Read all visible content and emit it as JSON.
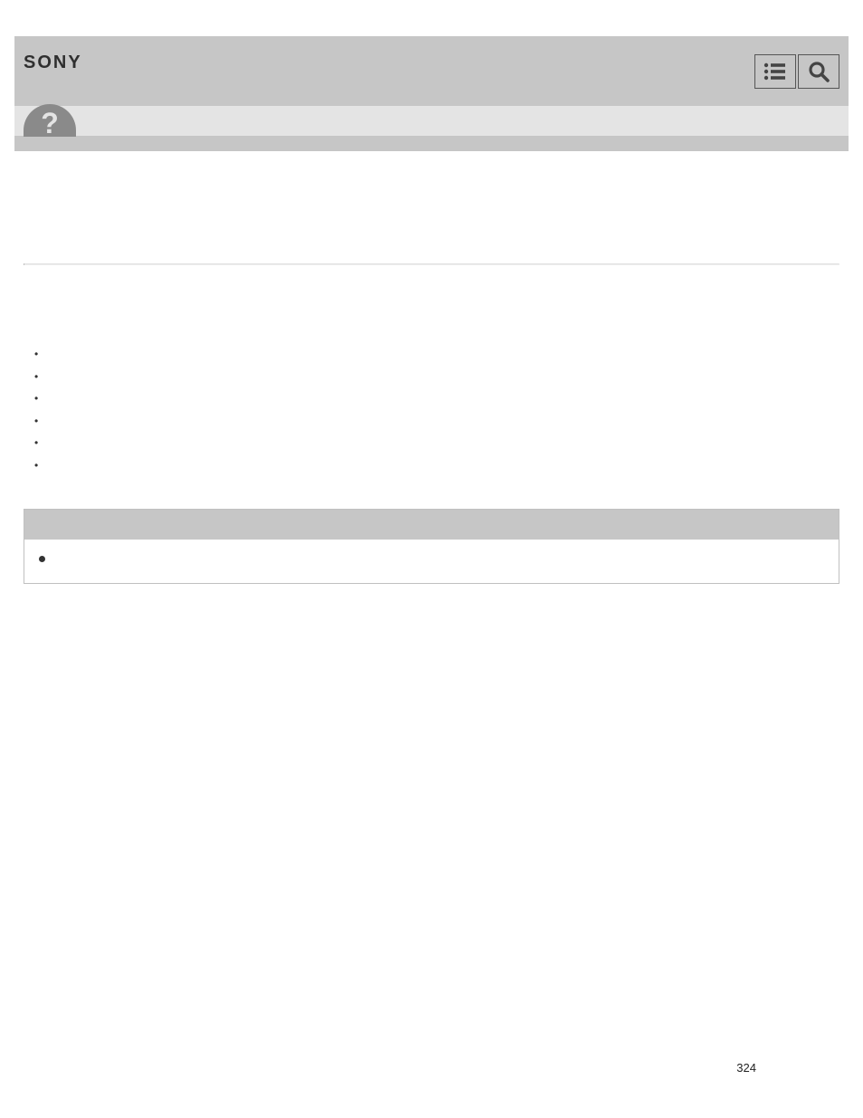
{
  "header": {
    "logo": "SONY"
  },
  "list_items": [
    "",
    "",
    "",
    "",
    "",
    ""
  ],
  "note": {
    "header": "",
    "items": [
      ""
    ]
  },
  "page_number": "324"
}
